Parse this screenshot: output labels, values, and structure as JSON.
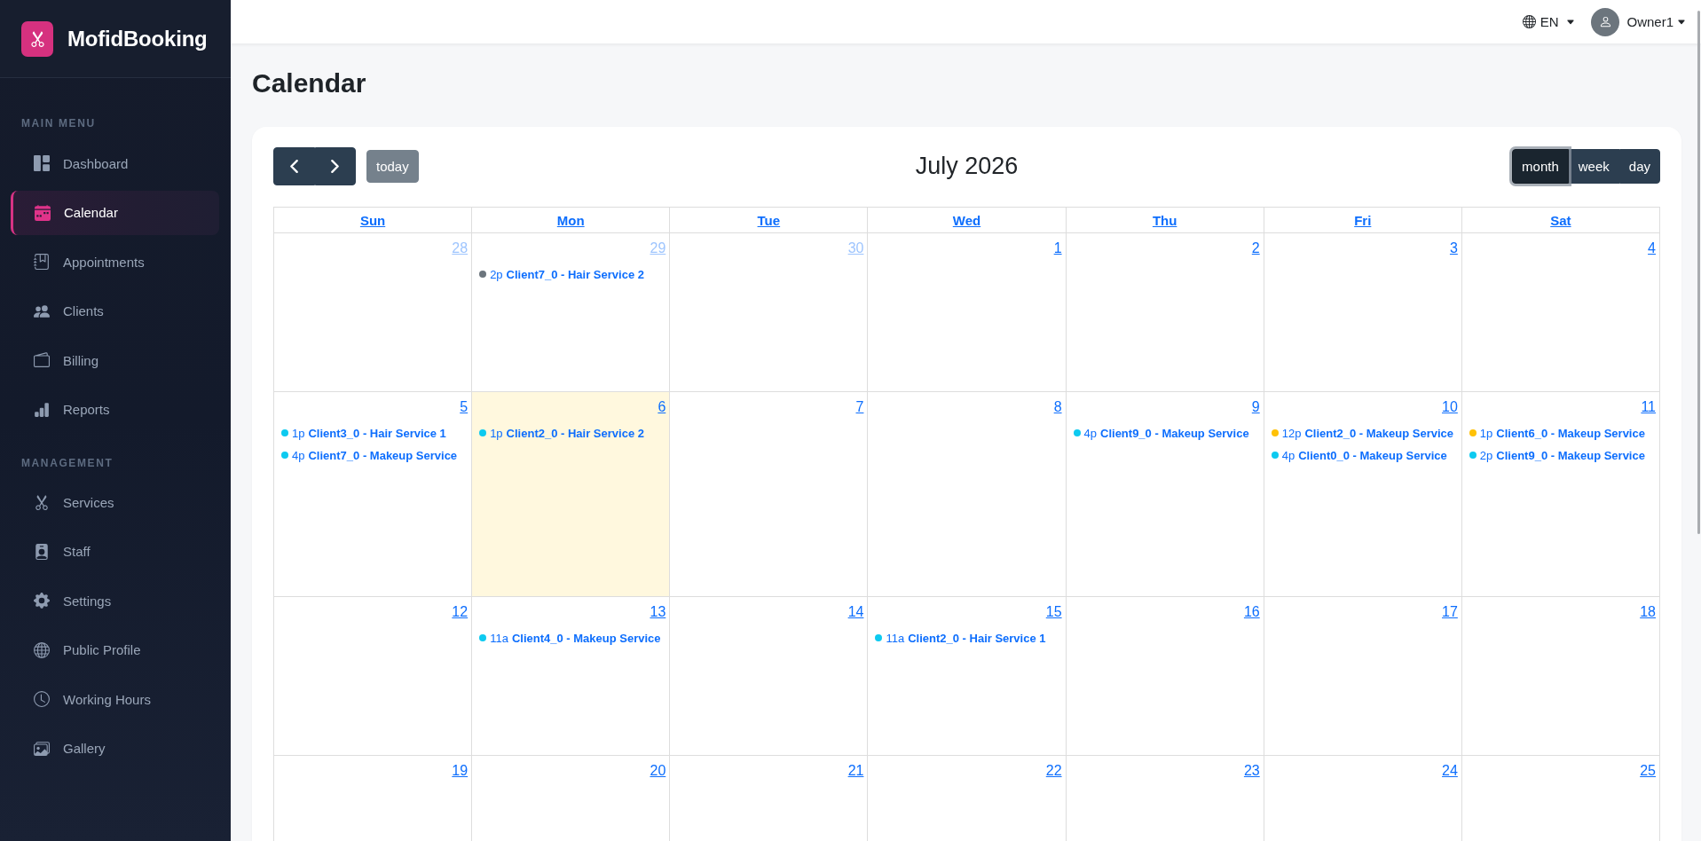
{
  "sidebar": {
    "brand": "MofidBooking",
    "sections": [
      {
        "title": "MAIN MENU",
        "items": [
          {
            "label": "Dashboard",
            "selected": false
          },
          {
            "label": "Calendar",
            "selected": true
          },
          {
            "label": "Appointments",
            "selected": false
          },
          {
            "label": "Clients",
            "selected": false
          },
          {
            "label": "Billing",
            "selected": false
          },
          {
            "label": "Reports",
            "selected": false
          }
        ]
      },
      {
        "title": "MANAGEMENT",
        "items": [
          {
            "label": "Services",
            "selected": false
          },
          {
            "label": "Staff",
            "selected": false
          },
          {
            "label": "Settings",
            "selected": false
          },
          {
            "label": "Public Profile",
            "selected": false
          },
          {
            "label": "Working Hours",
            "selected": false
          },
          {
            "label": "Gallery",
            "selected": false
          }
        ]
      }
    ]
  },
  "topbar": {
    "language": "EN",
    "user": "Owner1"
  },
  "page_title": "Calendar",
  "calendar": {
    "title": "July 2026",
    "today_button": {
      "label": "today",
      "disabled": true
    },
    "views": [
      {
        "label": "month",
        "selected": true
      },
      {
        "label": "week",
        "selected": false
      },
      {
        "label": "day",
        "selected": false
      }
    ],
    "weekdays": [
      "Sun",
      "Mon",
      "Tue",
      "Wed",
      "Thu",
      "Fri",
      "Sat"
    ],
    "weeks": [
      {
        "days": [
          {
            "day": "28",
            "other_month": true,
            "today": false
          },
          {
            "day": "29",
            "other_month": true,
            "today": false,
            "events": [
              {
                "time": "2p",
                "title": "Client7_0 - Hair Service 2",
                "color": "#6c757d"
              }
            ]
          },
          {
            "day": "30",
            "other_month": true,
            "today": false
          },
          {
            "day": "1",
            "other_month": false,
            "today": false
          },
          {
            "day": "2",
            "other_month": false,
            "today": false
          },
          {
            "day": "3",
            "other_month": false,
            "today": false
          },
          {
            "day": "4",
            "other_month": false,
            "today": false
          }
        ]
      },
      {
        "days": [
          {
            "day": "5",
            "other_month": false,
            "today": false,
            "events": [
              {
                "time": "1p",
                "title": "Client3_0 - Hair Service 1",
                "color": "#0dcaf0"
              },
              {
                "time": "4p",
                "title": "Client7_0 - Makeup Service",
                "color": "#0dcaf0"
              }
            ]
          },
          {
            "day": "6",
            "other_month": false,
            "today": true,
            "events": [
              {
                "time": "1p",
                "title": "Client2_0 - Hair Service 2",
                "color": "#0dcaf0"
              }
            ]
          },
          {
            "day": "7",
            "other_month": false,
            "today": false
          },
          {
            "day": "8",
            "other_month": false,
            "today": false
          },
          {
            "day": "9",
            "other_month": false,
            "today": false,
            "events": [
              {
                "time": "4p",
                "title": "Client9_0 - Makeup Service",
                "color": "#0dcaf0"
              }
            ]
          },
          {
            "day": "10",
            "other_month": false,
            "today": false,
            "events": [
              {
                "time": "12p",
                "title": "Client2_0 - Makeup Service",
                "color": "#ffc107"
              },
              {
                "time": "4p",
                "title": "Client0_0 - Makeup Service",
                "color": "#0dcaf0"
              }
            ]
          },
          {
            "day": "11",
            "other_month": false,
            "today": false,
            "events": [
              {
                "time": "1p",
                "title": "Client6_0 - Makeup Service",
                "color": "#ffc107"
              },
              {
                "time": "2p",
                "title": "Client9_0 - Makeup Service",
                "color": "#0dcaf0"
              }
            ]
          }
        ]
      },
      {
        "days": [
          {
            "day": "12",
            "other_month": false,
            "today": false
          },
          {
            "day": "13",
            "other_month": false,
            "today": false,
            "events": [
              {
                "time": "11a",
                "title": "Client4_0 - Makeup Service",
                "color": "#0dcaf0"
              }
            ]
          },
          {
            "day": "14",
            "other_month": false,
            "today": false
          },
          {
            "day": "15",
            "other_month": false,
            "today": false,
            "events": [
              {
                "time": "11a",
                "title": "Client2_0 - Hair Service 1",
                "color": "#0dcaf0"
              }
            ]
          },
          {
            "day": "16",
            "other_month": false,
            "today": false
          },
          {
            "day": "17",
            "other_month": false,
            "today": false
          },
          {
            "day": "18",
            "other_month": false,
            "today": false
          }
        ]
      },
      {
        "days": [
          {
            "day": "19",
            "other_month": false,
            "today": false
          },
          {
            "day": "20",
            "other_month": false,
            "today": false
          },
          {
            "day": "21",
            "other_month": false,
            "today": false
          },
          {
            "day": "22",
            "other_month": false,
            "today": false
          },
          {
            "day": "23",
            "other_month": false,
            "today": false
          },
          {
            "day": "24",
            "other_month": false,
            "today": false
          },
          {
            "day": "25",
            "other_month": false,
            "today": false
          }
        ]
      }
    ]
  }
}
